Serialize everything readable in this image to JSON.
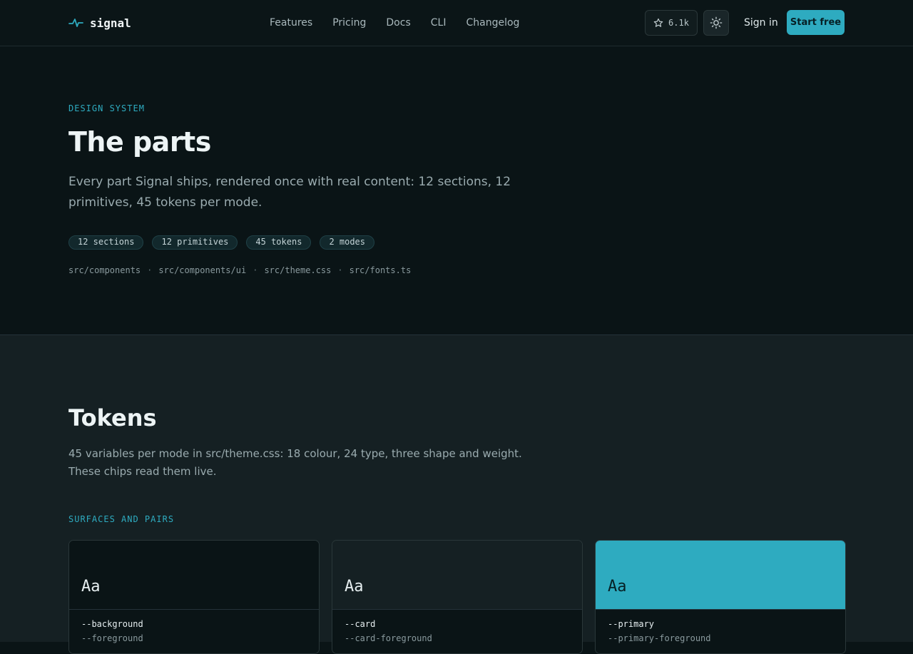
{
  "nav": {
    "brand": "signal",
    "links": [
      "Features",
      "Pricing",
      "Docs",
      "CLI",
      "Changelog"
    ],
    "stars": "6.1k",
    "sign_in": "Sign in",
    "start": "Start free"
  },
  "hero": {
    "eyebrow": "DESIGN SYSTEM",
    "title": "The parts",
    "subtitle": "Every part Signal ships, rendered once with real content: 12 sections, 12 primitives, 45 tokens per mode.",
    "chips": [
      "12 sections",
      "12 primitives",
      "45 tokens",
      "2 modes"
    ],
    "paths": [
      "src/components",
      "src/components/ui",
      "src/theme.css",
      "src/fonts.ts"
    ],
    "path_separator": "·"
  },
  "tokens": {
    "title": "Tokens",
    "subtitle": "45 variables per mode in src/theme.css: 18 colour, 24 type, three shape and weight. These chips read them live.",
    "eyebrow": "SURFACES AND PAIRS",
    "cards": [
      {
        "sample": "Aa",
        "var": "--background",
        "pair": "--foreground",
        "bg": "#0a1416",
        "fg": "#e6eef0"
      },
      {
        "sample": "Aa",
        "var": "--card",
        "pair": "--card-foreground",
        "bg": "#152023",
        "fg": "#e6eef0"
      },
      {
        "sample": "Aa",
        "var": "--primary",
        "pair": "--primary-foreground",
        "bg": "#2eabc0",
        "fg": "#062025"
      }
    ]
  },
  "colors": {
    "accent": "#2eabc0",
    "background": "#0a1416",
    "surface": "#152023"
  },
  "icons": {
    "logo": "pulse-icon",
    "star": "star-icon",
    "theme": "sun-icon"
  }
}
